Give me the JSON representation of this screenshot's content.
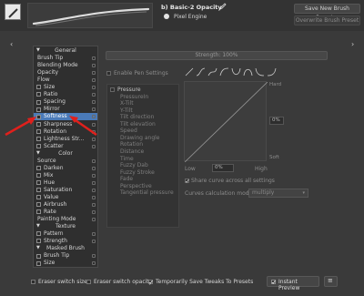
{
  "header": {
    "preset_name": "b) Basic-2 Opacity",
    "engine": "Pixel Engine",
    "save_new": "Save New Brush Preset...",
    "overwrite": "Overwrite Brush Preset"
  },
  "strength": "Strength: 100%",
  "tree": [
    {
      "label": "General",
      "type": "hdr"
    },
    {
      "label": "Brush Tip",
      "type": "item"
    },
    {
      "label": "Blending Mode",
      "type": "item"
    },
    {
      "label": "Opacity",
      "type": "item"
    },
    {
      "label": "Flow",
      "type": "item"
    },
    {
      "label": "Size",
      "type": "cb"
    },
    {
      "label": "Ratio",
      "type": "cb"
    },
    {
      "label": "Spacing",
      "type": "cb"
    },
    {
      "label": "Mirror",
      "type": "cb"
    },
    {
      "label": "Softness",
      "type": "cb",
      "selected": true
    },
    {
      "label": "Sharpness",
      "type": "cb"
    },
    {
      "label": "Rotation",
      "type": "cb"
    },
    {
      "label": "Lightness Str...",
      "type": "cb"
    },
    {
      "label": "Scatter",
      "type": "cb"
    },
    {
      "label": "Color",
      "type": "hdr"
    },
    {
      "label": "Source",
      "type": "item"
    },
    {
      "label": "Darken",
      "type": "cb"
    },
    {
      "label": "Mix",
      "type": "cb"
    },
    {
      "label": "Hue",
      "type": "cb"
    },
    {
      "label": "Saturation",
      "type": "cb"
    },
    {
      "label": "Value",
      "type": "cb"
    },
    {
      "label": "Airbrush",
      "type": "cb"
    },
    {
      "label": "Rate",
      "type": "cb"
    },
    {
      "label": "Painting Mode",
      "type": "item"
    },
    {
      "label": "Texture",
      "type": "hdr"
    },
    {
      "label": "Pattern",
      "type": "cb"
    },
    {
      "label": "Strength",
      "type": "cb"
    },
    {
      "label": "Masked Brush",
      "type": "hdr"
    },
    {
      "label": "Brush Tip",
      "type": "cb"
    },
    {
      "label": "Size",
      "type": "cb"
    }
  ],
  "enable_pen": "Enable Pen Settings",
  "sensors": [
    "Pressure",
    "PressureIn",
    "X-Tilt",
    "Y-Tilt",
    "Tilt direction",
    "Tilt elevation",
    "Speed",
    "Drawing angle",
    "Rotation",
    "Distance",
    "Time",
    "Fuzzy Dab",
    "Fuzzy Stroke",
    "Fade",
    "Perspective",
    "Tangential pressure"
  ],
  "curve": {
    "hard": "Hard",
    "soft": "Soft",
    "low": "Low",
    "high": "High",
    "low_val": "0%",
    "mid_val": "0%"
  },
  "share_curve": "Share curve across all settings",
  "calc_mode_label": "Curves calculation mode:",
  "calc_mode_value": "multiply",
  "footer": {
    "eraser_size": "Eraser switch size",
    "eraser_opacity": "Eraser switch opacity",
    "temp_save": "Temporarily Save Tweaks To Presets",
    "instant_preview": "Instant Preview"
  },
  "colors": {
    "selection": "#4a7ab8",
    "arrow": "#e0201c"
  }
}
